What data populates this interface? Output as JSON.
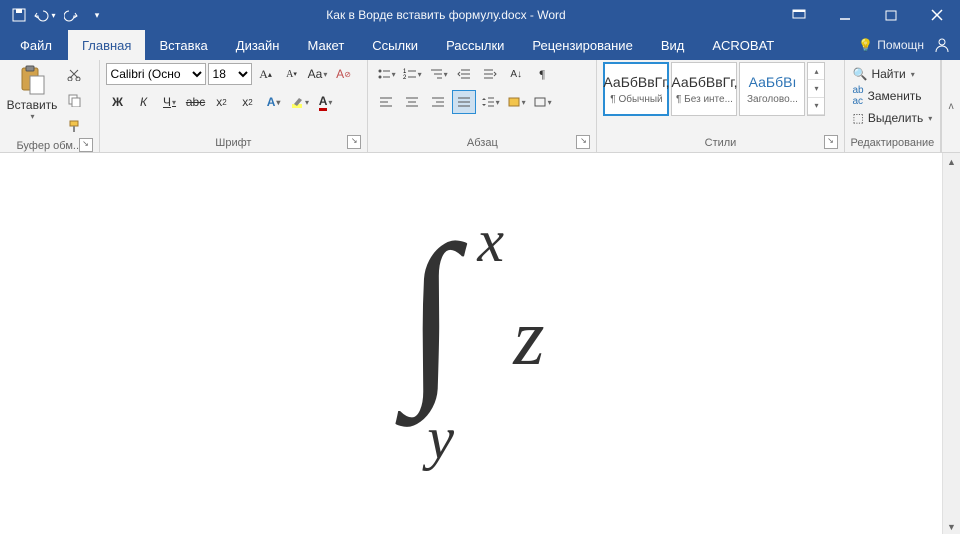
{
  "title": "Как в Ворде вставить формулу.docx - Word",
  "tabs": {
    "file": "Файл",
    "home": "Главная",
    "insert": "Вставка",
    "design": "Дизайн",
    "layout": "Макет",
    "references": "Ссылки",
    "mailings": "Рассылки",
    "review": "Рецензирование",
    "view": "Вид",
    "acrobat": "ACROBAT"
  },
  "tell_me": "Помощн",
  "ribbon": {
    "clipboard": {
      "paste": "Вставить",
      "label": "Буфер обм..."
    },
    "font": {
      "name": "Calibri (Осно",
      "size": "18",
      "label": "Шрифт",
      "bold": "Ж",
      "italic": "К",
      "underline": "Ч",
      "strike": "abc",
      "sub": "x₂",
      "sup": "x²",
      "caps": "Aa",
      "clear": "⨂"
    },
    "paragraph": {
      "label": "Абзац"
    },
    "styles": {
      "label": "Стили",
      "items": [
        {
          "sample": "АаБбВвГг,",
          "name": "¶ Обычный"
        },
        {
          "sample": "АаБбВвГг,",
          "name": "¶ Без инте..."
        },
        {
          "sample": "АаБбВı",
          "name": "Заголово..."
        }
      ]
    },
    "editing": {
      "label": "Редактирование",
      "find": "Найти",
      "replace": "Заменить",
      "select": "Выделить"
    }
  },
  "equation": {
    "upper": "x",
    "lower": "y",
    "body": "z"
  }
}
